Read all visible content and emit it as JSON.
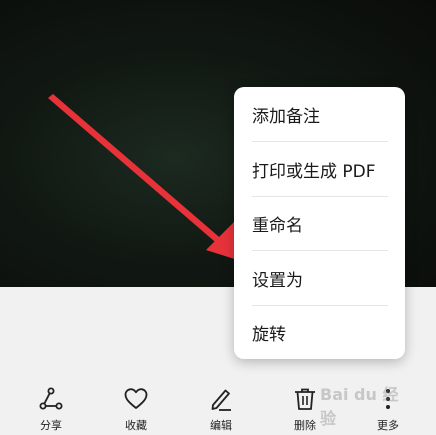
{
  "menu": {
    "items": [
      {
        "label": "添加备注"
      },
      {
        "label": "打印或生成 PDF"
      },
      {
        "label": "重命名"
      },
      {
        "label": "设置为"
      },
      {
        "label": "旋转"
      }
    ]
  },
  "toolbar": {
    "share": {
      "label": "分享",
      "icon": "share-icon"
    },
    "favorite": {
      "label": "收藏",
      "icon": "heart-icon"
    },
    "edit": {
      "label": "编辑",
      "icon": "pencil-icon"
    },
    "delete": {
      "label": "删除",
      "icon": "trash-icon"
    },
    "more": {
      "label": "更多",
      "icon": "more-vertical-icon"
    }
  },
  "watermark": {
    "text": "Bai du 经验"
  },
  "colors": {
    "arrow": "#e8323a",
    "photo_bg": "#111812",
    "menu_bg": "#ffffff",
    "toolbar_bg": "#f1f1f1"
  }
}
